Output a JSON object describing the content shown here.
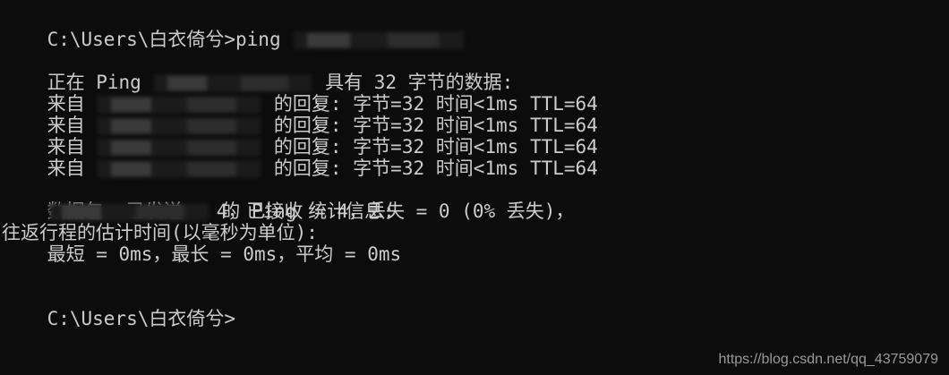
{
  "console": {
    "prompt_path": "C:\\Users\\白衣倚兮>",
    "command_text": "ping ",
    "ping_intro_prefix": "正在 Ping ",
    "ping_intro_suffix": "具有 32 字节的数据:",
    "reply_prefix": "来自 ",
    "reply_suffix": "的回复: 字节=32 时间<1ms TTL=64",
    "stats_suffix": "的 Ping 统计信息:",
    "packets_line": "    数据包: 已发送 = 4，已接收 = 4，丢失 = 0 (0% 丢失)，",
    "rtt_header": "往返行程的估计时间(以毫秒为单位):",
    "rtt_values": "    最短 = 0ms，最长 = 0ms，平均 = 0ms",
    "final_prompt": "C:\\Users\\白衣倚兮>"
  },
  "watermark": "https://blog.csdn.net/qq_43759079"
}
